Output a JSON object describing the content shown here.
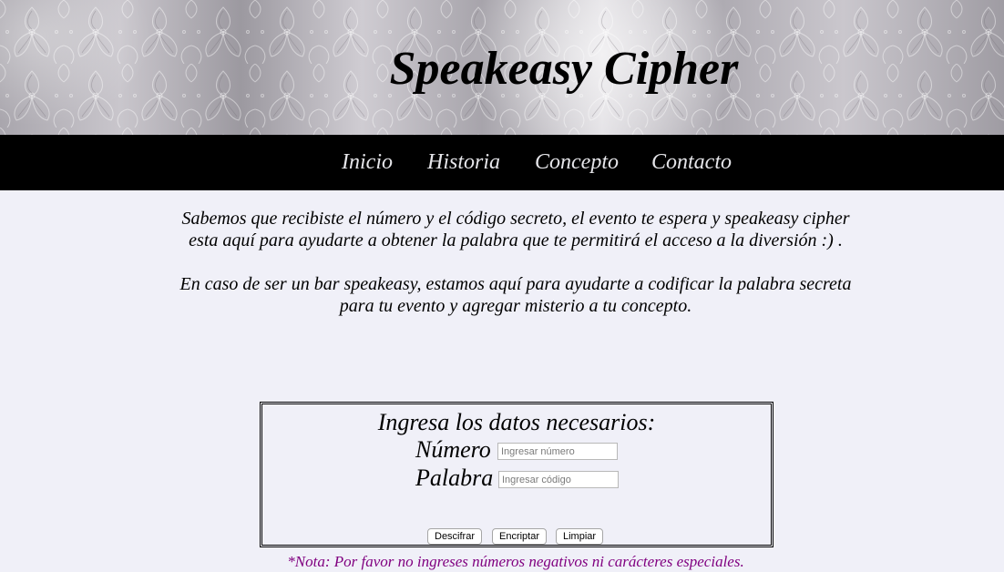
{
  "header": {
    "title": "Speakeasy Cipher"
  },
  "nav": {
    "items": [
      "Inicio",
      "Historia",
      "Concepto",
      "Contacto"
    ]
  },
  "intro": {
    "paragraph_1": "Sabemos que recibiste el número y el código secreto, el evento te espera y speakeasy cipher esta aquí para ayudarte a obtener la palabra que te permitirá el acceso a la diversión :) .",
    "paragraph_2": "En caso de ser un bar speakeasy, estamos aquí para ayudarte a codificar la palabra secreta para tu evento y agregar misterio a tu concepto."
  },
  "form": {
    "title": "Ingresa los datos necesarios:",
    "number_label": "Número",
    "number_placeholder": "Ingresar número",
    "number_value": "",
    "word_label": "Palabra",
    "word_placeholder": "Ingresar código",
    "word_value": "",
    "buttons": {
      "decrypt": "Descifrar",
      "encrypt": "Encriptar",
      "clear": "Limpiar"
    }
  },
  "note": "*Nota: Por favor no ingreses números negativos ni carácteres especiales.",
  "colors": {
    "nav_background": "#000000",
    "page_background": "#f0f0f8",
    "note_text": "#800080"
  }
}
